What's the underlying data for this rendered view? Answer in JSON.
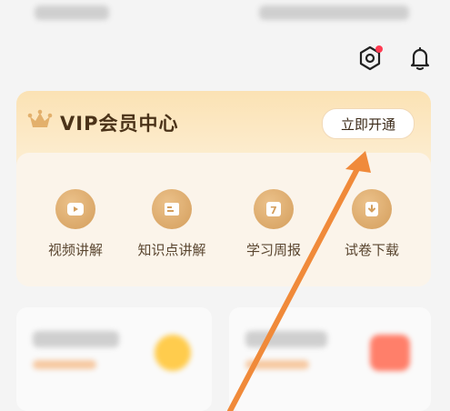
{
  "vip": {
    "title": "VIP会员中心",
    "open_button": "立即开通"
  },
  "features": [
    {
      "label": "视频讲解",
      "icon": "video-play-icon"
    },
    {
      "label": "知识点讲解",
      "icon": "knowledge-card-icon"
    },
    {
      "label": "学习周报",
      "icon": "calendar-7-icon"
    },
    {
      "label": "试卷下载",
      "icon": "download-icon"
    }
  ],
  "colors": {
    "accent": "#d49e5c",
    "card_bg": "#fdf0d8",
    "arrow": "#f08a3a",
    "notification_dot": "#ff3b52"
  }
}
